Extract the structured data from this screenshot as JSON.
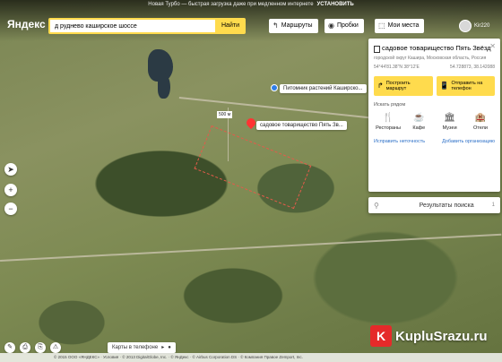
{
  "promo": {
    "text": "Новая Турбо — быстрая загрузка даже при медленном интернете",
    "action": "УСТАНОВИТЬ"
  },
  "logo": "Яндекс",
  "search": {
    "value": "д руднево каширское шоссе",
    "clear": "✕",
    "button": "Найти"
  },
  "header": {
    "routes": "Маршруты",
    "traffic": "Пробки",
    "myplaces": "Мои места",
    "user": "Kir220"
  },
  "map": {
    "poi_label": "Питомник растений Каширско...",
    "pin_label": "садовое товарищество Пять Зв...",
    "distance_label": "500 м"
  },
  "card": {
    "close": "✕",
    "title": "садовое товарищество Пять Звёзд",
    "address": "городской округ Кашира, Московская область, Россия",
    "coord_left": "54°44'81.38\"N 38°12'E",
    "coord_right": "54.728873, 38.142088",
    "route_btn": "Построить маршрут",
    "send_btn": "Отправить на телефон",
    "nearby_title": "Искать рядом",
    "nearby": [
      {
        "icon": "🍴",
        "label": "Рестораны"
      },
      {
        "icon": "☕",
        "label": "Кафе"
      },
      {
        "icon": "🏛",
        "label": "Музеи"
      },
      {
        "icon": "🏨",
        "label": "Отели"
      }
    ],
    "fix_link": "Исправить неточность",
    "add_link": "Добавить организацию"
  },
  "results": {
    "label": "Результаты поиска",
    "count": "1"
  },
  "phone_pill": "Карты в телефоне",
  "footer": "© 2015 ООО «ЯНДЕКС» · Условия · © 2013 DigitalGlobe, Inc. · © ЯнДекс · © Airbus Corporation DS · © Компания Правое Zemport, Inc.",
  "watermark": {
    "badge": "K",
    "text": "KupluSrazu.ru"
  }
}
